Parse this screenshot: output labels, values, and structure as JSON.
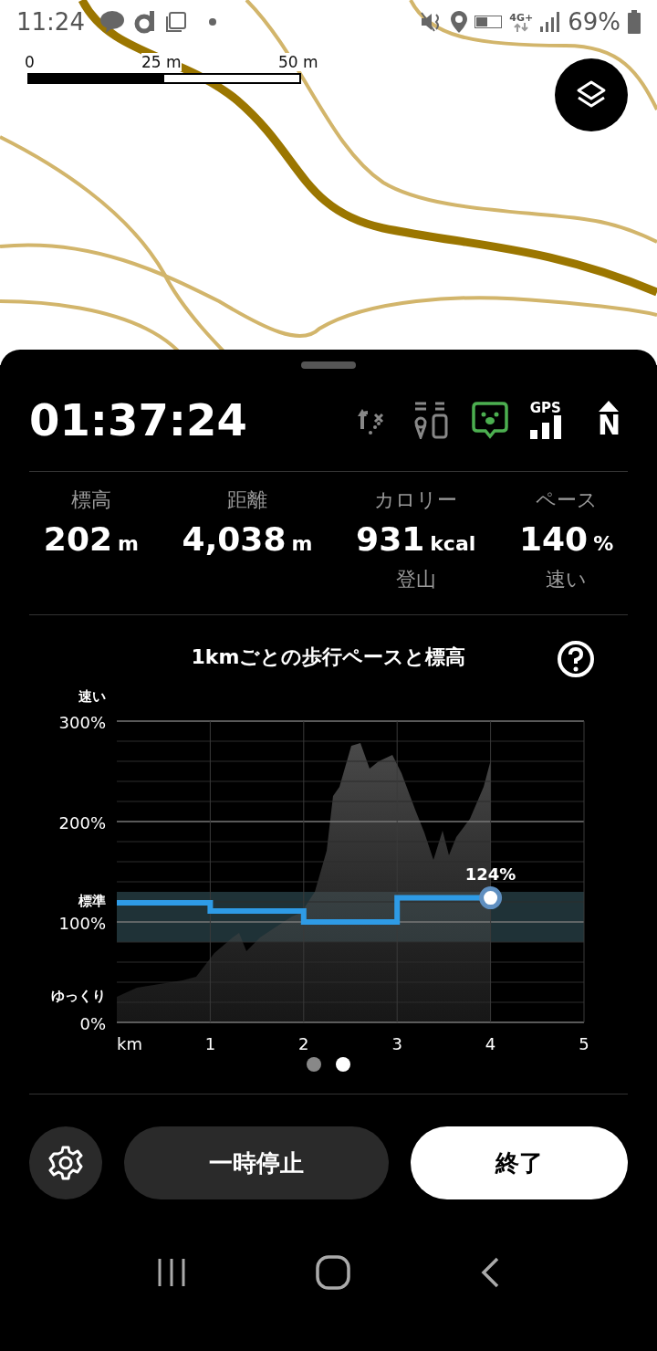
{
  "status_bar": {
    "time": "11:24",
    "network": "4G+",
    "battery": "69%"
  },
  "map": {
    "kind": "picture",
    "scale": [
      "0",
      "25 m",
      "50 m"
    ]
  },
  "tracker": {
    "elapsed": "01:37:24",
    "voice_guide": {
      "on": true
    },
    "gps_label": "GPS",
    "compass_label": "N"
  },
  "stats": [
    {
      "label": "標高",
      "value": "202",
      "unit": "m"
    },
    {
      "label": "距離",
      "value": "4,038",
      "unit": "m"
    },
    {
      "label": "カロリー",
      "value": "931",
      "unit": "kcal",
      "note": "登山"
    },
    {
      "label": "ペース",
      "value": "140",
      "unit": "%",
      "note": "速い"
    }
  ],
  "chart": {
    "title": "1kmごとの歩行ペースと標高",
    "side_labels": [
      "速い",
      "標準",
      "ゆっくり"
    ],
    "chart_data": {
      "type": "line",
      "x": [
        0,
        1,
        1,
        2,
        2,
        3,
        3,
        4
      ],
      "series": [
        {
          "color": "#2e9be6",
          "values": [
            119,
            119,
            111,
            111,
            100,
            100,
            124,
            124
          ]
        }
      ],
      "grid": true,
      "xlim": [
        0,
        5
      ],
      "ylim": [
        0,
        300
      ],
      "xticks": [
        {
          "value": 0,
          "label": "km"
        },
        {
          "value": 1,
          "label": "1"
        },
        {
          "value": 2,
          "label": "2"
        },
        {
          "value": 3,
          "label": "3"
        },
        {
          "value": 4,
          "label": "4"
        },
        {
          "value": 5,
          "label": "5"
        }
      ],
      "yticks": [
        {
          "value": 0,
          "label": "0%"
        },
        {
          "value": 100,
          "label": "100%"
        },
        {
          "value": 200,
          "label": "200%"
        },
        {
          "value": 300,
          "label": "300%"
        }
      ],
      "annotations": [
        {
          "x": 4,
          "y": 124,
          "text": "124%"
        }
      ]
    }
  },
  "pages": [
    {
      "selected": false
    },
    {
      "selected": true
    }
  ],
  "buttons": {
    "pause": "一時停止",
    "finish": "終了"
  }
}
